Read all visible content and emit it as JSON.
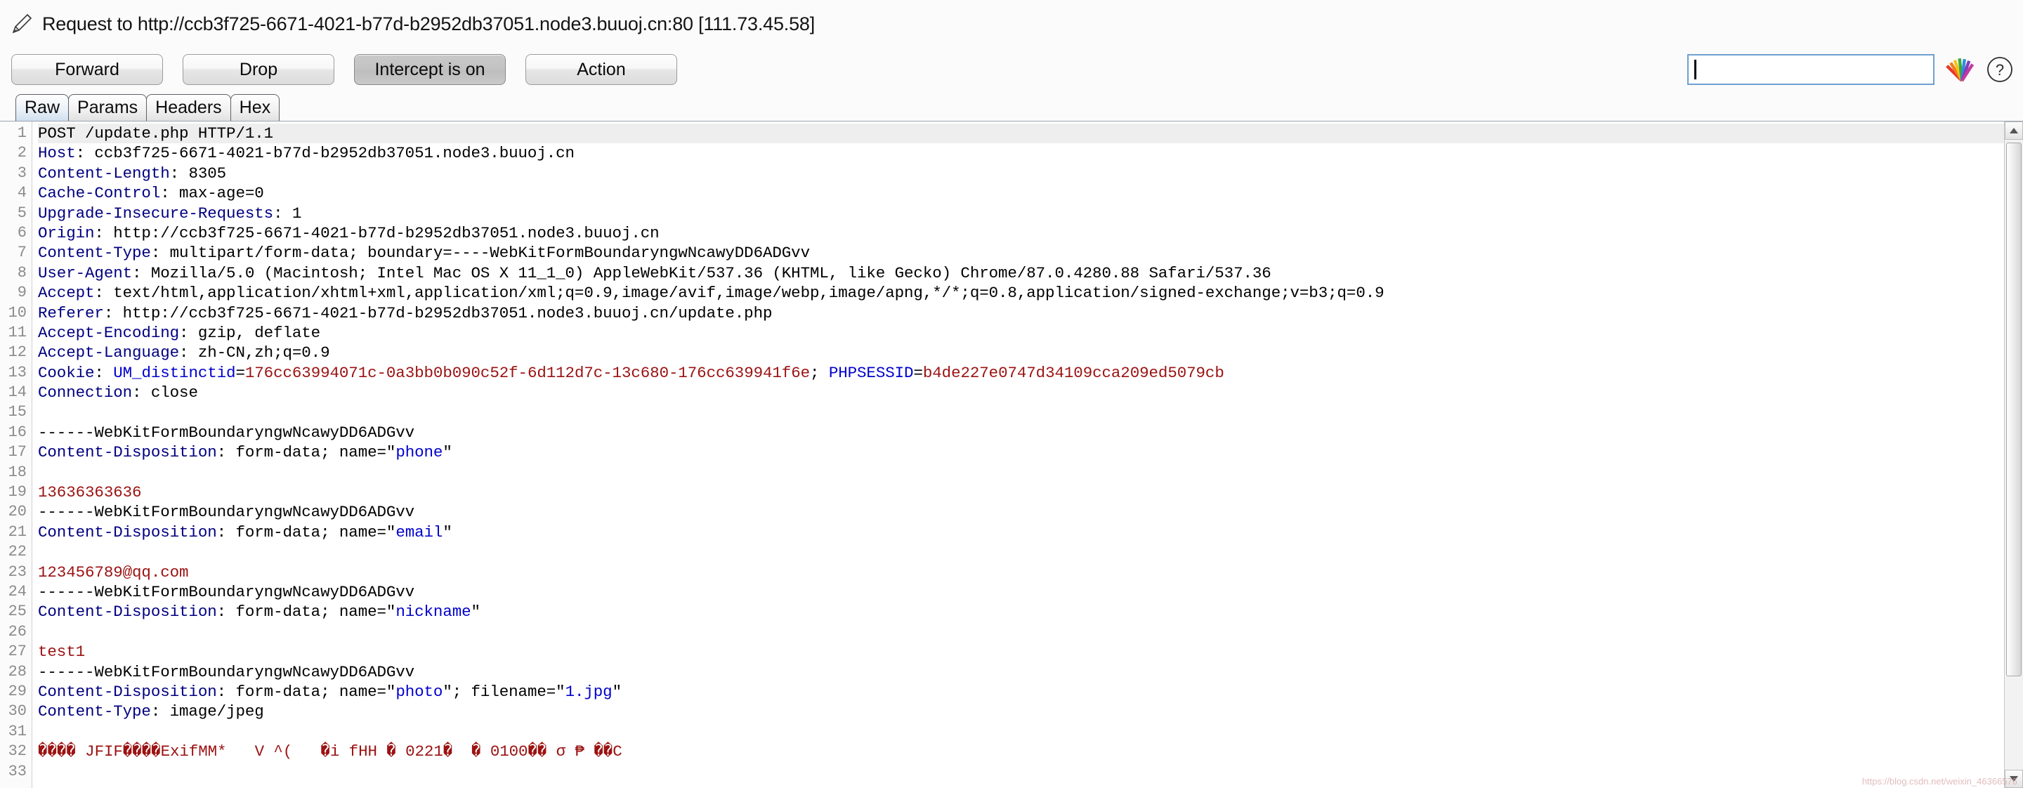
{
  "window": {
    "title": "Request to http://ccb3f725-6671-4021-b77d-b2952db37051.node3.buuoj.cn:80  [111.73.45.58]",
    "edit_icon": "pencil-icon"
  },
  "toolbar": {
    "forward_label": "Forward",
    "drop_label": "Drop",
    "intercept_label": "Intercept is on",
    "action_label": "Action",
    "intercept_pressed": true,
    "search": {
      "value": "",
      "placeholder": ""
    },
    "logo_icon": "burp-suite-logo-icon",
    "help_icon": "help-question-icon"
  },
  "tabs": {
    "active": "Raw",
    "items": [
      {
        "label": "Raw"
      },
      {
        "label": "Params"
      },
      {
        "label": "Headers"
      },
      {
        "label": "Hex"
      }
    ]
  },
  "colors": {
    "header_name": "#000080",
    "cookie_name": "#0000cd",
    "value_red": "#9b1212",
    "tab_active_bg": "#cfe0ef",
    "search_border": "#6f9fd0"
  },
  "editor": {
    "first_line_highlight": true,
    "line_count": 33,
    "lines": [
      {
        "n": 1,
        "segs": [
          {
            "t": "POST /update.php HTTP/1.1",
            "c": "plain"
          }
        ]
      },
      {
        "n": 2,
        "segs": [
          {
            "t": "Host",
            "c": "hname"
          },
          {
            "t": ": ccb3f725-6671-4021-b77d-b2952db37051.node3.buuoj.cn",
            "c": "plain"
          }
        ]
      },
      {
        "n": 3,
        "segs": [
          {
            "t": "Content-Length",
            "c": "hname"
          },
          {
            "t": ": 8305",
            "c": "plain"
          }
        ]
      },
      {
        "n": 4,
        "segs": [
          {
            "t": "Cache-Control",
            "c": "hname"
          },
          {
            "t": ": max-age=0",
            "c": "plain"
          }
        ]
      },
      {
        "n": 5,
        "segs": [
          {
            "t": "Upgrade-Insecure-Requests",
            "c": "hname"
          },
          {
            "t": ": 1",
            "c": "plain"
          }
        ]
      },
      {
        "n": 6,
        "segs": [
          {
            "t": "Origin",
            "c": "hname"
          },
          {
            "t": ": http://ccb3f725-6671-4021-b77d-b2952db37051.node3.buuoj.cn",
            "c": "plain"
          }
        ]
      },
      {
        "n": 7,
        "segs": [
          {
            "t": "Content-Type",
            "c": "hname"
          },
          {
            "t": ": multipart/form-data; boundary=----WebKitFormBoundaryngwNcawyDD6ADGvv",
            "c": "plain"
          }
        ]
      },
      {
        "n": 8,
        "segs": [
          {
            "t": "User-Agent",
            "c": "hname"
          },
          {
            "t": ": Mozilla/5.0 (Macintosh; Intel Mac OS X 11_1_0) AppleWebKit/537.36 (KHTML, like Gecko) Chrome/87.0.4280.88 Safari/537.36",
            "c": "plain"
          }
        ]
      },
      {
        "n": 9,
        "segs": [
          {
            "t": "Accept",
            "c": "hname"
          },
          {
            "t": ": text/html,application/xhtml+xml,application/xml;q=0.9,image/avif,image/webp,image/apng,*/*;q=0.8,application/signed-exchange;v=b3;q=0.9",
            "c": "plain"
          }
        ]
      },
      {
        "n": 10,
        "segs": [
          {
            "t": "Referer",
            "c": "hname"
          },
          {
            "t": ": http://ccb3f725-6671-4021-b77d-b2952db37051.node3.buuoj.cn/update.php",
            "c": "plain"
          }
        ]
      },
      {
        "n": 11,
        "segs": [
          {
            "t": "Accept-Encoding",
            "c": "hname"
          },
          {
            "t": ": gzip, deflate",
            "c": "plain"
          }
        ]
      },
      {
        "n": 12,
        "segs": [
          {
            "t": "Accept-Language",
            "c": "hname"
          },
          {
            "t": ": zh-CN,zh;q=0.9",
            "c": "plain"
          }
        ]
      },
      {
        "n": 13,
        "segs": [
          {
            "t": "Cookie",
            "c": "hname"
          },
          {
            "t": ": ",
            "c": "plain"
          },
          {
            "t": "UM_distinctid",
            "c": "cname"
          },
          {
            "t": "=",
            "c": "plain"
          },
          {
            "t": "176cc63994071c-0a3bb0b090c52f-6d112d7c-13c680-176cc639941f6e",
            "c": "cval"
          },
          {
            "t": "; ",
            "c": "plain"
          },
          {
            "t": "PHPSESSID",
            "c": "cname"
          },
          {
            "t": "=",
            "c": "plain"
          },
          {
            "t": "b4de227e0747d34109cca209ed5079cb",
            "c": "cval"
          }
        ]
      },
      {
        "n": 14,
        "segs": [
          {
            "t": "Connection",
            "c": "hname"
          },
          {
            "t": ": close",
            "c": "plain"
          }
        ]
      },
      {
        "n": 15,
        "segs": [
          {
            "t": "",
            "c": "plain"
          }
        ]
      },
      {
        "n": 16,
        "segs": [
          {
            "t": "------WebKitFormBoundaryngwNcawyDD6ADGvv",
            "c": "plain"
          }
        ]
      },
      {
        "n": 17,
        "segs": [
          {
            "t": "Content-Disposition",
            "c": "hname"
          },
          {
            "t": ": form-data; name=\"",
            "c": "plain"
          },
          {
            "t": "phone",
            "c": "cname"
          },
          {
            "t": "\"",
            "c": "plain"
          }
        ]
      },
      {
        "n": 18,
        "segs": [
          {
            "t": "",
            "c": "plain"
          }
        ]
      },
      {
        "n": 19,
        "segs": [
          {
            "t": "13636363636",
            "c": "bodyval"
          }
        ]
      },
      {
        "n": 20,
        "segs": [
          {
            "t": "------WebKitFormBoundaryngwNcawyDD6ADGvv",
            "c": "plain"
          }
        ]
      },
      {
        "n": 21,
        "segs": [
          {
            "t": "Content-Disposition",
            "c": "hname"
          },
          {
            "t": ": form-data; name=\"",
            "c": "plain"
          },
          {
            "t": "email",
            "c": "cname"
          },
          {
            "t": "\"",
            "c": "plain"
          }
        ]
      },
      {
        "n": 22,
        "segs": [
          {
            "t": "",
            "c": "plain"
          }
        ]
      },
      {
        "n": 23,
        "segs": [
          {
            "t": "123456789@qq.com",
            "c": "bodyval"
          }
        ]
      },
      {
        "n": 24,
        "segs": [
          {
            "t": "------WebKitFormBoundaryngwNcawyDD6ADGvv",
            "c": "plain"
          }
        ]
      },
      {
        "n": 25,
        "segs": [
          {
            "t": "Content-Disposition",
            "c": "hname"
          },
          {
            "t": ": form-data; name=\"",
            "c": "plain"
          },
          {
            "t": "nickname",
            "c": "cname"
          },
          {
            "t": "\"",
            "c": "plain"
          }
        ]
      },
      {
        "n": 26,
        "segs": [
          {
            "t": "",
            "c": "plain"
          }
        ]
      },
      {
        "n": 27,
        "segs": [
          {
            "t": "test1",
            "c": "bodyval"
          }
        ]
      },
      {
        "n": 28,
        "segs": [
          {
            "t": "------WebKitFormBoundaryngwNcawyDD6ADGvv",
            "c": "plain"
          }
        ]
      },
      {
        "n": 29,
        "segs": [
          {
            "t": "Content-Disposition",
            "c": "hname"
          },
          {
            "t": ": form-data; name=\"",
            "c": "plain"
          },
          {
            "t": "photo",
            "c": "cname"
          },
          {
            "t": "\"; filename=\"",
            "c": "plain"
          },
          {
            "t": "1.jpg",
            "c": "cname"
          },
          {
            "t": "\"",
            "c": "plain"
          }
        ]
      },
      {
        "n": 30,
        "segs": [
          {
            "t": "Content-Type",
            "c": "hname"
          },
          {
            "t": ": image/jpeg",
            "c": "plain"
          }
        ]
      },
      {
        "n": 31,
        "segs": [
          {
            "t": "",
            "c": "plain"
          }
        ]
      },
      {
        "n": 32,
        "segs": [
          {
            "t": "���� JFIF����ExifMM*   V ^(   �i fHH � 0221�  � 0100�� σ ₱ ��C",
            "c": "binary"
          }
        ]
      },
      {
        "n": 33,
        "segs": [
          {
            "t": "",
            "c": "plain"
          }
        ]
      }
    ]
  },
  "scrollbar": {
    "up_arrow_icon": "scroll-up-arrow-icon",
    "down_arrow_icon": "scroll-down-arrow-icon"
  },
  "watermark": {
    "text": "https://blog.csdn.net/weixin_46366576"
  }
}
